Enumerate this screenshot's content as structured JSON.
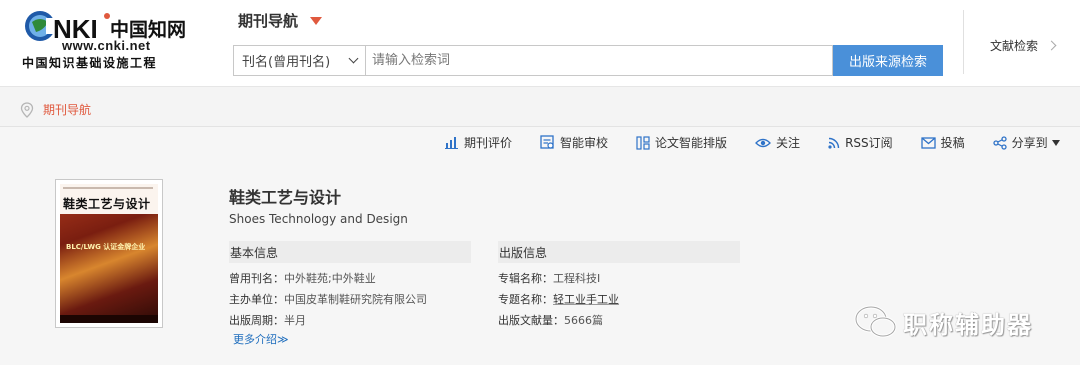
{
  "header": {
    "logo_site": "www.cnki.net",
    "logo_slogan": "中国知识基础设施工程",
    "nav_title": "期刊导航",
    "search": {
      "select_value": "刊名(曾用刊名)",
      "placeholder": "请输入检索词",
      "button_label": "出版来源检索"
    },
    "lit_search_label": "文献检索"
  },
  "breadcrumb": {
    "label": "期刊导航"
  },
  "actions": [
    {
      "icon": "chart-bar-icon",
      "label": "期刊评价"
    },
    {
      "icon": "review-icon",
      "label": "智能审校"
    },
    {
      "icon": "layout-icon",
      "label": "论文智能排版"
    },
    {
      "icon": "eye-icon",
      "label": "关注"
    },
    {
      "icon": "rss-icon",
      "label": "RSS订阅"
    },
    {
      "icon": "mail-icon",
      "label": "投稿"
    },
    {
      "icon": "share-icon",
      "label": "分享到"
    }
  ],
  "journal": {
    "cover_title": "鞋类工艺与设计",
    "cover_banner": "BLC/LWG 认证金牌企业",
    "title_cn": "鞋类工艺与设计",
    "title_en": "Shoes Technology and Design"
  },
  "basic_info": {
    "heading": "基本信息",
    "rows": [
      {
        "label": "曾用刊名：",
        "value": "中外鞋苑;中外鞋业"
      },
      {
        "label": "主办单位：",
        "value": "中国皮革制鞋研究院有限公司"
      },
      {
        "label": "出版周期：",
        "value": "半月"
      }
    ],
    "more": "更多介绍≫"
  },
  "pub_info": {
    "heading": "出版信息",
    "rows": [
      {
        "label": "专辑名称：",
        "value": "工程科技I"
      },
      {
        "label": "专题名称：",
        "value": "轻工业手工业"
      },
      {
        "label": "出版文献量：",
        "value": "5666篇"
      }
    ]
  },
  "watermark": {
    "text": "职称辅助器"
  },
  "colors": {
    "accent_orange": "#e0593e",
    "button_blue": "#4a90d9",
    "link_blue": "#1e6dbd",
    "action_icon_blue": "#2f73c8"
  }
}
